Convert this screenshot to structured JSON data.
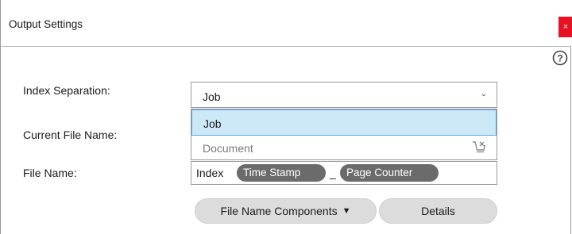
{
  "window": {
    "title": "Output Settings",
    "close_glyph": "×"
  },
  "help": {
    "icon": "help-circle-icon",
    "glyph": "?"
  },
  "fields": {
    "index_separation_label": "Index Separation:",
    "current_file_name_label": "Current File Name:",
    "file_name_label": "File Name:"
  },
  "index_separation": {
    "selected": "Job",
    "options": [
      {
        "label": "Job",
        "highlighted": true
      },
      {
        "label": "Document",
        "highlighted": false,
        "icon": "cart-icon"
      }
    ]
  },
  "file_name": {
    "prefix": "Index",
    "tokens": [
      "Time Stamp",
      "Page Counter"
    ],
    "separator": "_"
  },
  "buttons": {
    "file_name_components": "File Name Components",
    "file_name_components_arrow": "▼",
    "details": "Details"
  },
  "colors": {
    "accent_highlight": "#cce8f7",
    "accent_border": "#5aa9dd",
    "close_red": "#e81123",
    "token_bg": "#6b6b6b"
  }
}
